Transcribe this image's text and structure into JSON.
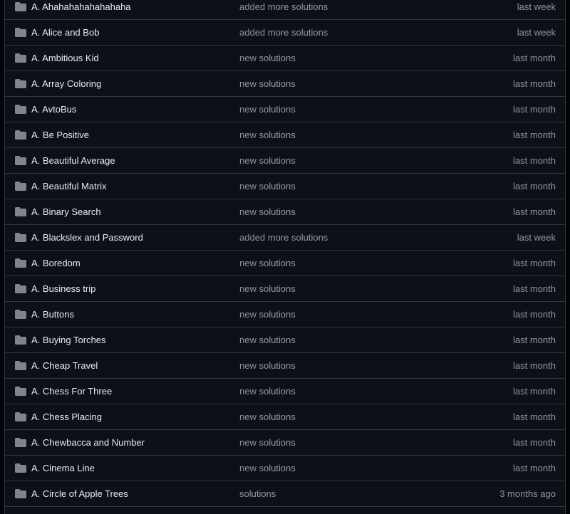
{
  "colors": {
    "page_bg": "#010409",
    "list_bg": "#0d1117",
    "border": "#30363d",
    "folder_icon": "#7d8590",
    "name_text": "#e6edf3",
    "muted_text": "#8d96a0"
  },
  "file_list": {
    "rows": [
      {
        "icon": "folder-icon",
        "name": "A. Ahahahahahahahaha",
        "commit": "added more solutions",
        "age": "last week"
      },
      {
        "icon": "folder-icon",
        "name": "A. Alice and Bob",
        "commit": "added more solutions",
        "age": "last week"
      },
      {
        "icon": "folder-icon",
        "name": "A. Ambitious Kid",
        "commit": "new solutions",
        "age": "last month"
      },
      {
        "icon": "folder-icon",
        "name": "A. Array Coloring",
        "commit": "new solutions",
        "age": "last month"
      },
      {
        "icon": "folder-icon",
        "name": "A. AvtoBus",
        "commit": "new solutions",
        "age": "last month"
      },
      {
        "icon": "folder-icon",
        "name": "A. Be Positive",
        "commit": "new solutions",
        "age": "last month"
      },
      {
        "icon": "folder-icon",
        "name": "A. Beautiful Average",
        "commit": "new solutions",
        "age": "last month"
      },
      {
        "icon": "folder-icon",
        "name": "A. Beautiful Matrix",
        "commit": "new solutions",
        "age": "last month"
      },
      {
        "icon": "folder-icon",
        "name": "A. Binary Search",
        "commit": "new solutions",
        "age": "last month"
      },
      {
        "icon": "folder-icon",
        "name": "A. Blackslex and Password",
        "commit": "added more solutions",
        "age": "last week"
      },
      {
        "icon": "folder-icon",
        "name": "A. Boredom",
        "commit": "new solutions",
        "age": "last month"
      },
      {
        "icon": "folder-icon",
        "name": "A. Business trip",
        "commit": "new solutions",
        "age": "last month"
      },
      {
        "icon": "folder-icon",
        "name": "A. Buttons",
        "commit": "new solutions",
        "age": "last month"
      },
      {
        "icon": "folder-icon",
        "name": "A. Buying Torches",
        "commit": "new solutions",
        "age": "last month"
      },
      {
        "icon": "folder-icon",
        "name": "A. Cheap Travel",
        "commit": "new solutions",
        "age": "last month"
      },
      {
        "icon": "folder-icon",
        "name": "A. Chess For Three",
        "commit": "new solutions",
        "age": "last month"
      },
      {
        "icon": "folder-icon",
        "name": "A. Chess Placing",
        "commit": "new solutions",
        "age": "last month"
      },
      {
        "icon": "folder-icon",
        "name": "A. Chewbacca and Number",
        "commit": "new solutions",
        "age": "last month"
      },
      {
        "icon": "folder-icon",
        "name": "A. Cinema Line",
        "commit": "new solutions",
        "age": "last month"
      },
      {
        "icon": "folder-icon",
        "name": "A. Circle of Apple Trees",
        "commit": "solutions",
        "age": "3 months ago"
      }
    ]
  }
}
